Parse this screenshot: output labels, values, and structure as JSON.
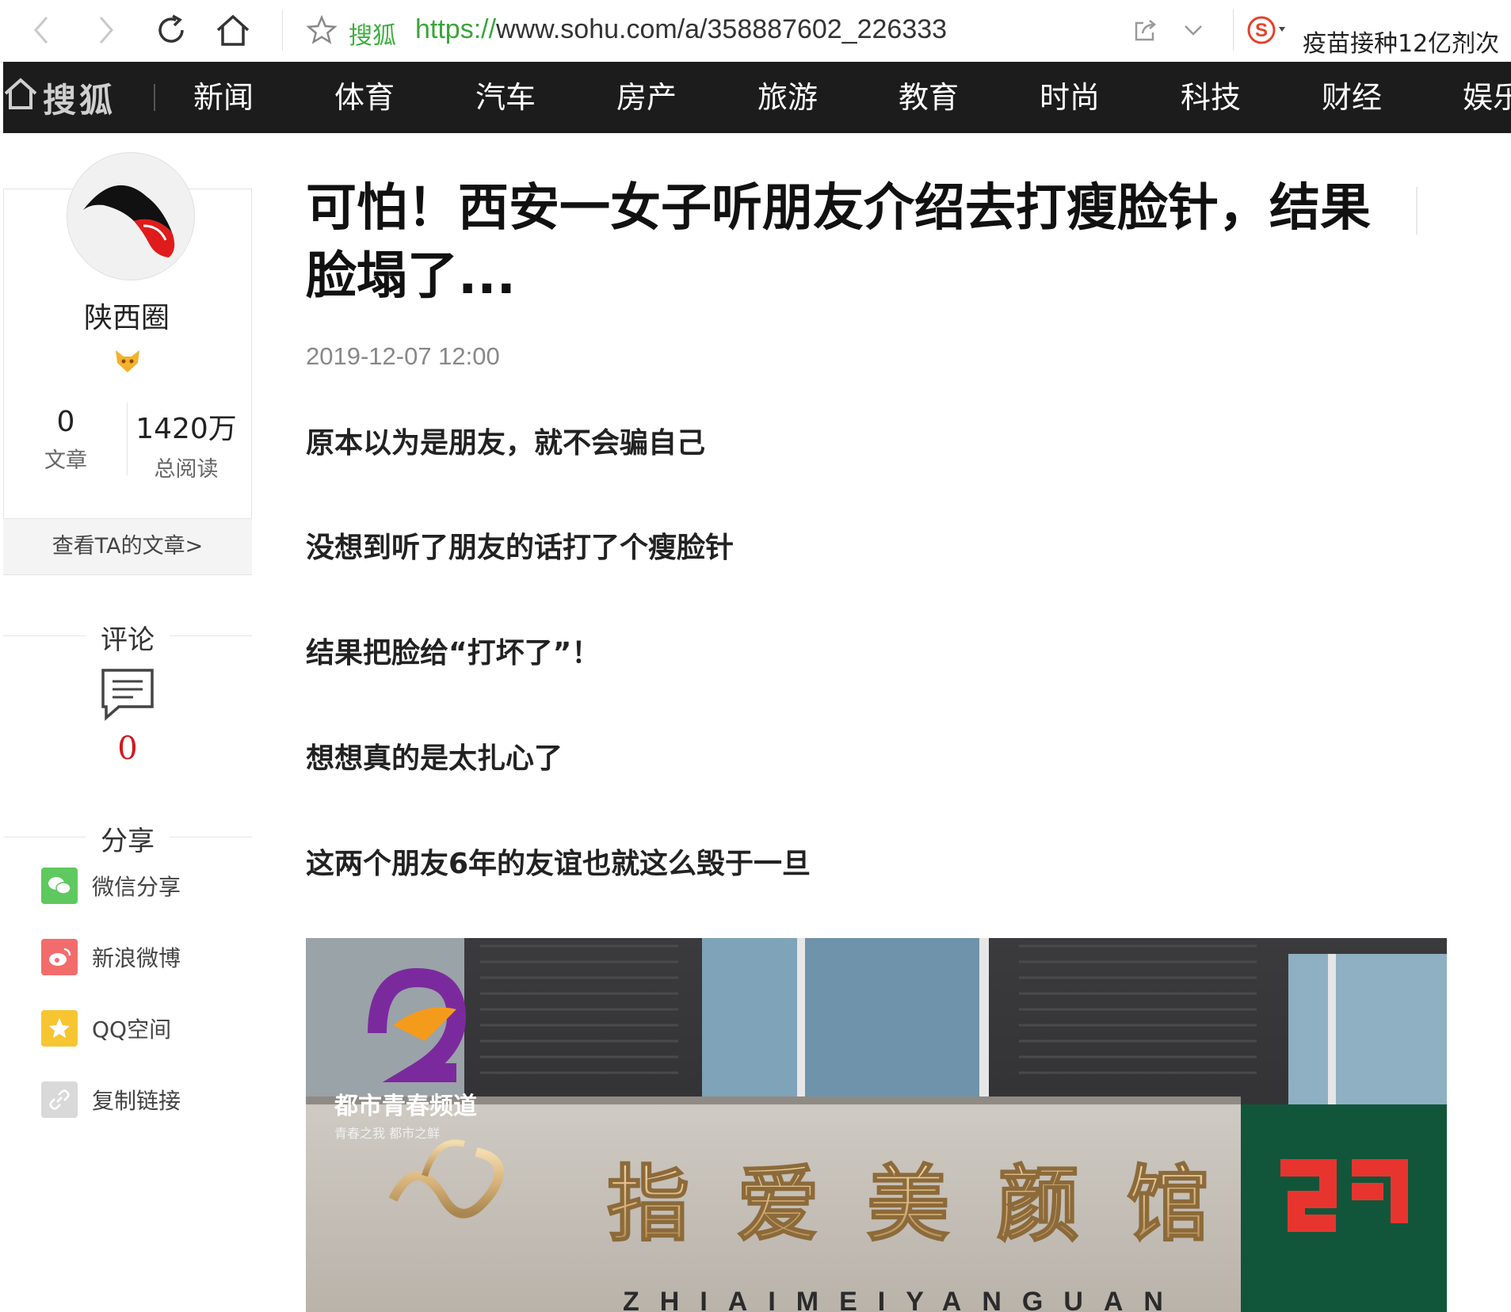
{
  "browser": {
    "site_name": "搜狐",
    "url_scheme": "https://",
    "url_rest": "www.sohu.com/a/358887602_226333",
    "search_hint": "疫苗接种12亿剂次"
  },
  "nav": {
    "logo": "搜狐",
    "items": [
      "新闻",
      "体育",
      "汽车",
      "房产",
      "旅游",
      "教育",
      "时尚",
      "科技",
      "财经",
      "娱乐"
    ]
  },
  "author": {
    "name": "陕西圈",
    "articles_count": "0",
    "articles_label": "文章",
    "reads_count": "1420万",
    "reads_label": "总阅读",
    "view_articles": "查看TA的文章>"
  },
  "comments": {
    "heading": "评论",
    "count": "0"
  },
  "share": {
    "heading": "分享",
    "items": [
      {
        "label": "微信分享",
        "icon": "wechat-icon",
        "color": "#5ec95e"
      },
      {
        "label": "新浪微博",
        "icon": "weibo-icon",
        "color": "#f36c6c"
      },
      {
        "label": "QQ空间",
        "icon": "qzone-icon",
        "color": "#f7c531"
      },
      {
        "label": "复制链接",
        "icon": "link-icon",
        "color": "#d9d9d9"
      }
    ]
  },
  "article": {
    "title": "可怕！西安一女子听朋友介绍去打瘦脸针，结果脸塌了...",
    "date": "2019-12-07 12:00",
    "paragraphs": [
      "原本以为是朋友，就不会骗自己",
      "没想到听了朋友的话打了个瘦脸针",
      "结果把脸给“打坏了”！",
      "想想真的是太扎心了",
      "这两个朋友6年的友谊也就这么毁于一旦"
    ],
    "image": {
      "channel_name": "都市青春频道",
      "channel_slogan": "青春之我  都市之鲜",
      "sign_text": "指爱美颜馆",
      "sign_pinyin": "ZHIAIMEIYANGUAN"
    }
  },
  "colors": {
    "nav_bg": "#1c1c1c",
    "accent_red": "#d0191f",
    "url_green": "#3aa53a"
  }
}
